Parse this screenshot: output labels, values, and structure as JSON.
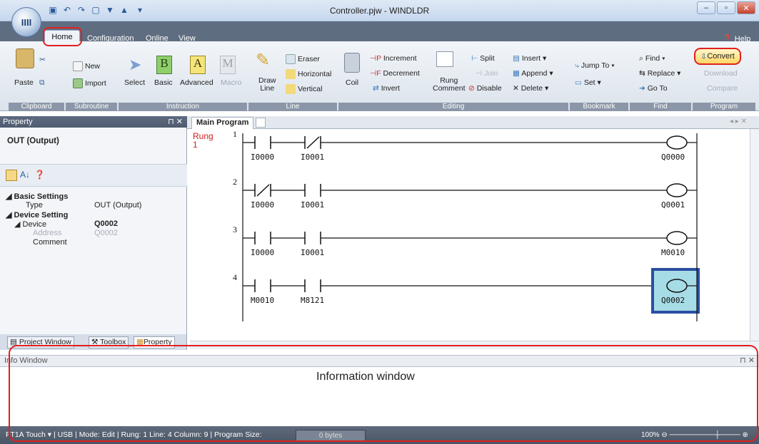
{
  "window": {
    "title": "Controller.pjw - WINDLDR",
    "app_logo": "IIII"
  },
  "menu_tabs": [
    "Home",
    "Configuration",
    "Online",
    "View"
  ],
  "help_label": "Help",
  "ribbon": {
    "groups": [
      "Clipboard",
      "Subroutine",
      "Instruction",
      "Line",
      "Editing",
      "Bookmark",
      "Find",
      "Program"
    ],
    "clipboard": {
      "paste": "Paste"
    },
    "subroutine": {
      "new": "New",
      "import": "Import"
    },
    "instruction": {
      "select": "Select",
      "basic": "Basic",
      "advanced": "Advanced",
      "macro": "Macro",
      "basic_icon": "B",
      "advanced_icon": "A",
      "macro_icon": "M"
    },
    "line": {
      "draw_line": "Draw\nLine",
      "eraser": "Eraser",
      "horizontal": "Horizontal",
      "vertical": "Vertical"
    },
    "editing": {
      "coil": "Coil",
      "increment": "Increment",
      "decrement": "Decrement",
      "invert": "Invert",
      "rung_comment": "Rung\nComment",
      "split": "Split",
      "join": "Join",
      "disable": "Disable",
      "insert": "Insert",
      "append": "Append",
      "delete": "Delete"
    },
    "bookmark": {
      "jump_to": "Jump To",
      "set": "Set"
    },
    "find": {
      "find": "Find",
      "replace": "Replace",
      "go_to": "Go To"
    },
    "program": {
      "convert": "Convert",
      "download": "Download",
      "compare": "Compare"
    }
  },
  "property_panel": {
    "header": "Property",
    "title": "OUT (Output)",
    "sections": [
      {
        "name": "Basic Settings",
        "rows": [
          {
            "key": "Type",
            "value": "OUT (Output)"
          }
        ]
      },
      {
        "name": "Device Setting",
        "rows": [
          {
            "key": "Device",
            "value": "Q0002"
          },
          {
            "key": "Address",
            "value": "Q0002"
          },
          {
            "key": "Comment",
            "value": ""
          }
        ]
      }
    ],
    "bottom_tabs": [
      "Project Window",
      "Toolbox",
      "Property"
    ]
  },
  "main": {
    "tab": "Main Program",
    "rung_label": "Rung\n1",
    "rungs": [
      {
        "num": "1",
        "contacts": [
          {
            "dev": "I0000",
            "type": "NO"
          },
          {
            "dev": "I0001",
            "type": "NC"
          }
        ],
        "coil": "Q0000"
      },
      {
        "num": "2",
        "contacts": [
          {
            "dev": "I0000",
            "type": "NC"
          },
          {
            "dev": "I0001",
            "type": "NO"
          }
        ],
        "coil": "Q0001"
      },
      {
        "num": "3",
        "contacts": [
          {
            "dev": "I0000",
            "type": "NO"
          },
          {
            "dev": "I0001",
            "type": "NO"
          }
        ],
        "coil": "M0010"
      },
      {
        "num": "4",
        "contacts": [
          {
            "dev": "M0010",
            "type": "NO"
          },
          {
            "dev": "M8121",
            "type": "NO"
          }
        ],
        "coil": "Q0002",
        "selected": true
      }
    ]
  },
  "info_window": {
    "header": "Info Window",
    "annotation": "Information window"
  },
  "status": {
    "text": "FT1A Touch ▾ | USB | Mode: Edit | Rung: 1  Line: 4  Column: 9 | Program Size:",
    "program_size": "0 bytes",
    "zoom": "100%"
  },
  "colors": {
    "accent": "#e02020",
    "selection": "#2b4ea3",
    "selection_fill": "#a6dce6"
  }
}
